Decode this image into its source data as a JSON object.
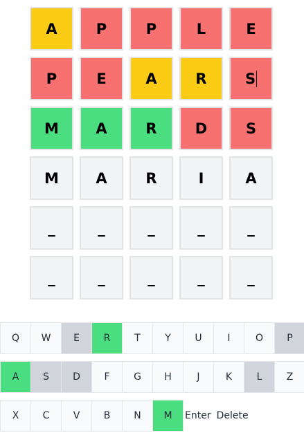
{
  "board": {
    "rows": [
      [
        {
          "letter": "A",
          "state": "present"
        },
        {
          "letter": "P",
          "state": "absent"
        },
        {
          "letter": "P",
          "state": "absent"
        },
        {
          "letter": "L",
          "state": "absent"
        },
        {
          "letter": "E",
          "state": "absent"
        }
      ],
      [
        {
          "letter": "P",
          "state": "absent"
        },
        {
          "letter": "E",
          "state": "absent"
        },
        {
          "letter": "A",
          "state": "present"
        },
        {
          "letter": "R",
          "state": "present"
        },
        {
          "letter": "S",
          "state": "absent",
          "cursor": true
        }
      ],
      [
        {
          "letter": "M",
          "state": "correct"
        },
        {
          "letter": "A",
          "state": "correct"
        },
        {
          "letter": "R",
          "state": "correct"
        },
        {
          "letter": "D",
          "state": "absent"
        },
        {
          "letter": "S",
          "state": "absent"
        }
      ],
      [
        {
          "letter": "M",
          "state": "empty"
        },
        {
          "letter": "A",
          "state": "empty"
        },
        {
          "letter": "R",
          "state": "empty"
        },
        {
          "letter": "I",
          "state": "empty"
        },
        {
          "letter": "A",
          "state": "empty"
        }
      ],
      [
        {
          "letter": "_",
          "state": "empty"
        },
        {
          "letter": "_",
          "state": "empty"
        },
        {
          "letter": "_",
          "state": "empty"
        },
        {
          "letter": "_",
          "state": "empty"
        },
        {
          "letter": "_",
          "state": "empty"
        }
      ],
      [
        {
          "letter": "_",
          "state": "empty"
        },
        {
          "letter": "_",
          "state": "empty"
        },
        {
          "letter": "_",
          "state": "empty"
        },
        {
          "letter": "_",
          "state": "empty"
        },
        {
          "letter": "_",
          "state": "empty"
        }
      ]
    ]
  },
  "keyboard": {
    "rows": [
      [
        {
          "label": "Q",
          "state": "normal"
        },
        {
          "label": "W",
          "state": "normal"
        },
        {
          "label": "E",
          "state": "used"
        },
        {
          "label": "R",
          "state": "hit"
        },
        {
          "label": "T",
          "state": "normal"
        },
        {
          "label": "Y",
          "state": "normal"
        },
        {
          "label": "U",
          "state": "normal"
        },
        {
          "label": "I",
          "state": "normal"
        },
        {
          "label": "O",
          "state": "normal"
        },
        {
          "label": "P",
          "state": "used"
        }
      ],
      [
        {
          "label": "A",
          "state": "hit"
        },
        {
          "label": "S",
          "state": "used"
        },
        {
          "label": "D",
          "state": "used"
        },
        {
          "label": "F",
          "state": "normal"
        },
        {
          "label": "G",
          "state": "normal"
        },
        {
          "label": "H",
          "state": "normal"
        },
        {
          "label": "J",
          "state": "normal"
        },
        {
          "label": "K",
          "state": "normal"
        },
        {
          "label": "L",
          "state": "used"
        },
        {
          "label": "Z",
          "state": "normal"
        }
      ],
      [
        {
          "label": "X",
          "state": "normal"
        },
        {
          "label": "C",
          "state": "normal"
        },
        {
          "label": "V",
          "state": "normal"
        },
        {
          "label": "B",
          "state": "normal"
        },
        {
          "label": "N",
          "state": "normal"
        },
        {
          "label": "M",
          "state": "hit"
        },
        {
          "label": "Enter",
          "state": "text"
        },
        {
          "label": "Delete",
          "state": "text"
        }
      ]
    ]
  },
  "colors": {
    "correct": "#4ade80",
    "present": "#facc15",
    "absent": "#f87171",
    "empty": "#f3f4f6",
    "key_used": "#d1d5db",
    "key_hit": "#4ade80"
  }
}
